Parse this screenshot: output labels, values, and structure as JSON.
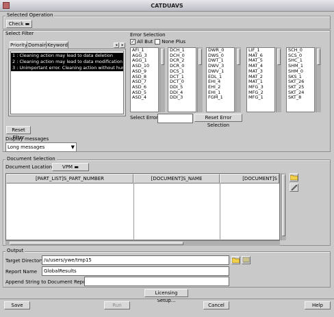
{
  "window": {
    "title": "CATDUAVS"
  },
  "selected_operation": {
    "group_label": "Selected Operation",
    "dropdown_value": "Check"
  },
  "select_filter": {
    "group_label": "Select Filter",
    "tabs": [
      "Priority",
      "Domain",
      "Keyword"
    ],
    "priority_items": [
      "1 : Cleaning action may lead to data deletion",
      "2 : Cleaning action may lead to data modification",
      "3 : Unimportant error. Cleaning action without hur"
    ],
    "reset_label": "Reset Filter"
  },
  "error_selection": {
    "label": "Error Selection",
    "all_but_label": "All But",
    "all_but_checked": true,
    "none_plus_label": "None Plus",
    "none_plus_checked": false,
    "columns": [
      [
        "AFI_1",
        "AGG_3",
        "AGG_1",
        "ASD_10",
        "ASD_9",
        "ASD_8",
        "ASD_7",
        "ASD_6",
        "ASD_5",
        "ASD_4"
      ],
      [
        "DCH_1",
        "DCH_0",
        "DCR_2",
        "DCR_0",
        "DCS_1",
        "DCT_1",
        "DCT_0",
        "DDI_5",
        "DDI_4",
        "DDI_3"
      ],
      [
        "DWR_0",
        "DWS_0",
        "DWT_1",
        "DWV_3",
        "DWV_1",
        "EDL_1",
        "EHI_4",
        "EHI_2",
        "EHI_1",
        "FGM_1"
      ],
      [
        "LIF_1",
        "MAT_6",
        "MAT_5",
        "MAT_4",
        "MAT_3",
        "MAT_2",
        "MAT_1",
        "MFG_3",
        "MFG_2",
        "MFG_1"
      ],
      [
        "SCH_0",
        "SCS_0",
        "SHC_1",
        "SHM_1",
        "SHM_0",
        "SKS_1",
        "SKT_26",
        "SKT_25",
        "SKT_24",
        "SKT_8"
      ]
    ],
    "select_error_label": "Select Error",
    "select_error_value": "",
    "reset_label": "Reset Error Selection"
  },
  "display_messages": {
    "label": "Display messages",
    "value": "Long messages"
  },
  "document_selection": {
    "group_label": "Document Selection",
    "location_label": "Document Location",
    "location_value": "VPM",
    "columns": [
      "[PART_LIST]S_PART_NUMBER",
      "[DOCUMENT]S_NAME",
      "[DOCUMENT]S"
    ]
  },
  "output": {
    "group_label": "Output",
    "target_dir_label": "Target Directory",
    "target_dir_value": "/u/users/ywe/tmp15",
    "report_name_label": "Report Name",
    "report_name_value": "GlobalResults",
    "append_label": "Append String to Document Report",
    "append_value": ""
  },
  "licensing_button": "Licensing Setup...",
  "footer": {
    "save": "Save",
    "run": "Run",
    "cancel": "Cancel",
    "help": "Help"
  }
}
